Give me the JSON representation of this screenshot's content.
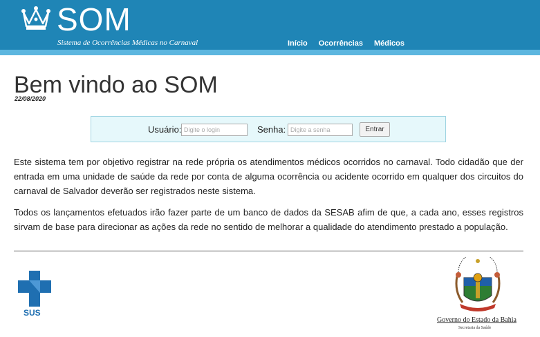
{
  "header": {
    "title": "SOM",
    "subtitle": "Sistema de Ocorrências Médicas no Carnaval",
    "nav": [
      "Início",
      "Ocorrências",
      "Médicos"
    ]
  },
  "main": {
    "heading": "Bem vindo ao SOM",
    "date": "22/08/2020"
  },
  "login": {
    "user_label": "Usuário:",
    "user_placeholder": "Digite o login",
    "pass_label": "Senha:",
    "pass_placeholder": "Digite a senha",
    "submit_label": "Entrar"
  },
  "content": {
    "paragraphs": [
      "Este sistema tem por objetivo registrar na rede própria os atendimentos médicos ocorridos no carnaval. Todo cidadão que der entrada em uma unidade de saúde da rede por conta de alguma ocorrência ou acidente ocorrido em qualquer dos circuitos do carnaval de Salvador deverão ser registrados neste sistema.",
      "Todos os lançamentos efetuados irão fazer parte de um banco de dados da SESAB afim de que, a cada ano, esses registros sirvam de base para direcionar as ações da rede no sentido de melhorar a qualidade do atendimento prestado a população."
    ]
  },
  "footer": {
    "sus_label": "SUS",
    "gov_title": "Governo do Estado da Bahia",
    "gov_subtitle": "Secretaria da Saúde"
  },
  "colors": {
    "header_bg": "#1f85b6",
    "header_strip": "#5cb6df",
    "login_bg": "#e6f8fb",
    "sus_blue": "#1f6fb1"
  },
  "icons": {
    "logo": "crown-icon",
    "sus": "sus-cross-icon",
    "coat": "bahia-coat-of-arms-icon"
  }
}
